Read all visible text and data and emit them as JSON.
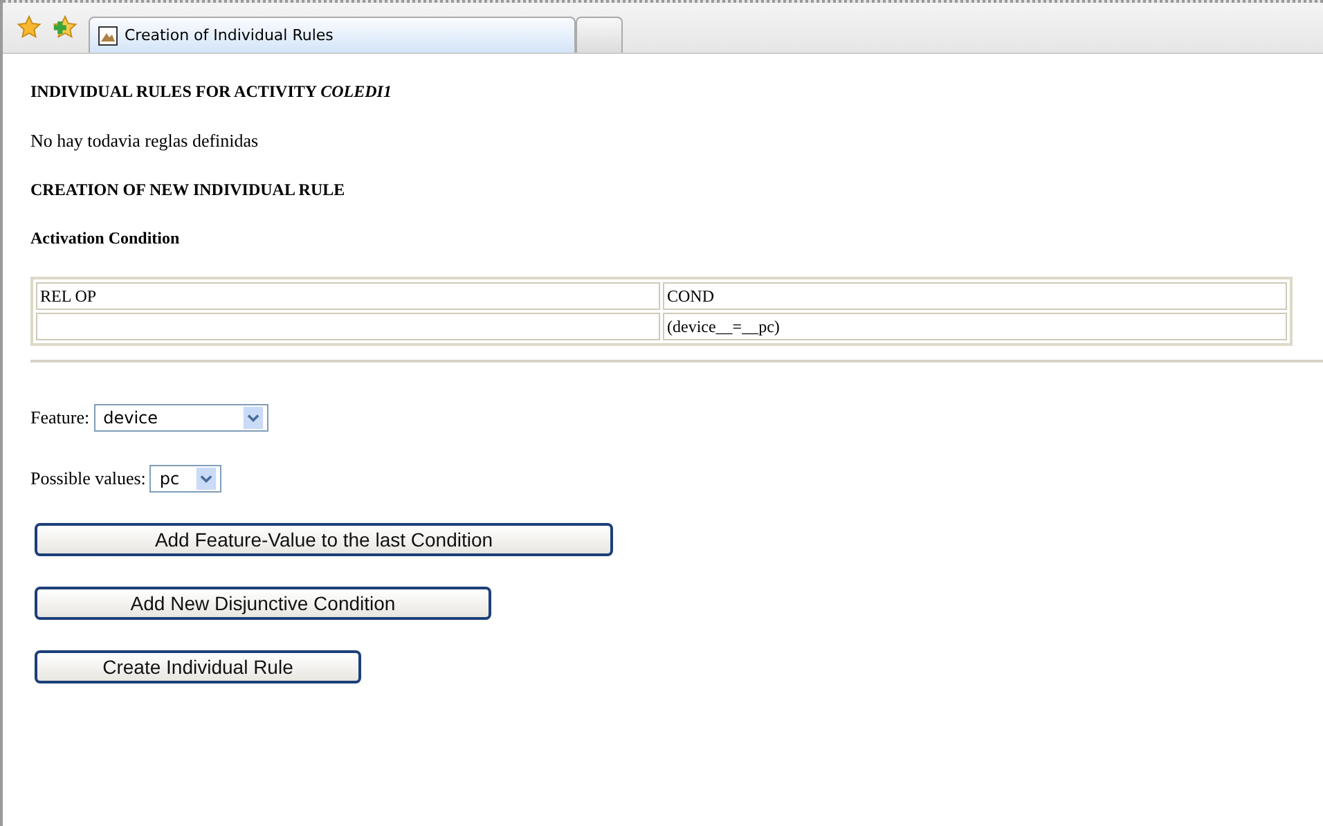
{
  "tabs": [
    {
      "label": "Creation of Individual Rules",
      "selected": true
    }
  ],
  "heading": "INDIVIDUAL RULES FOR ACTIVITY *COLEDI1*",
  "message": "No hay todavia reglas definidas",
  "section_title": "CREATION OF NEW INDIVIDUAL RULE",
  "subsection_title": "Activation Condition",
  "table": {
    "columns": [
      "REL OP",
      "COND"
    ],
    "rows": [
      [
        "",
        "(device__=__pc)"
      ]
    ]
  },
  "feature": {
    "label": "Feature:",
    "value": "device"
  },
  "possible_values": {
    "label": "Possible values:",
    "value": "pc"
  },
  "buttons": [
    "Add Feature-Value to the last Condition",
    "Add New Disjunctive Condition",
    "Create Individual Rule"
  ]
}
